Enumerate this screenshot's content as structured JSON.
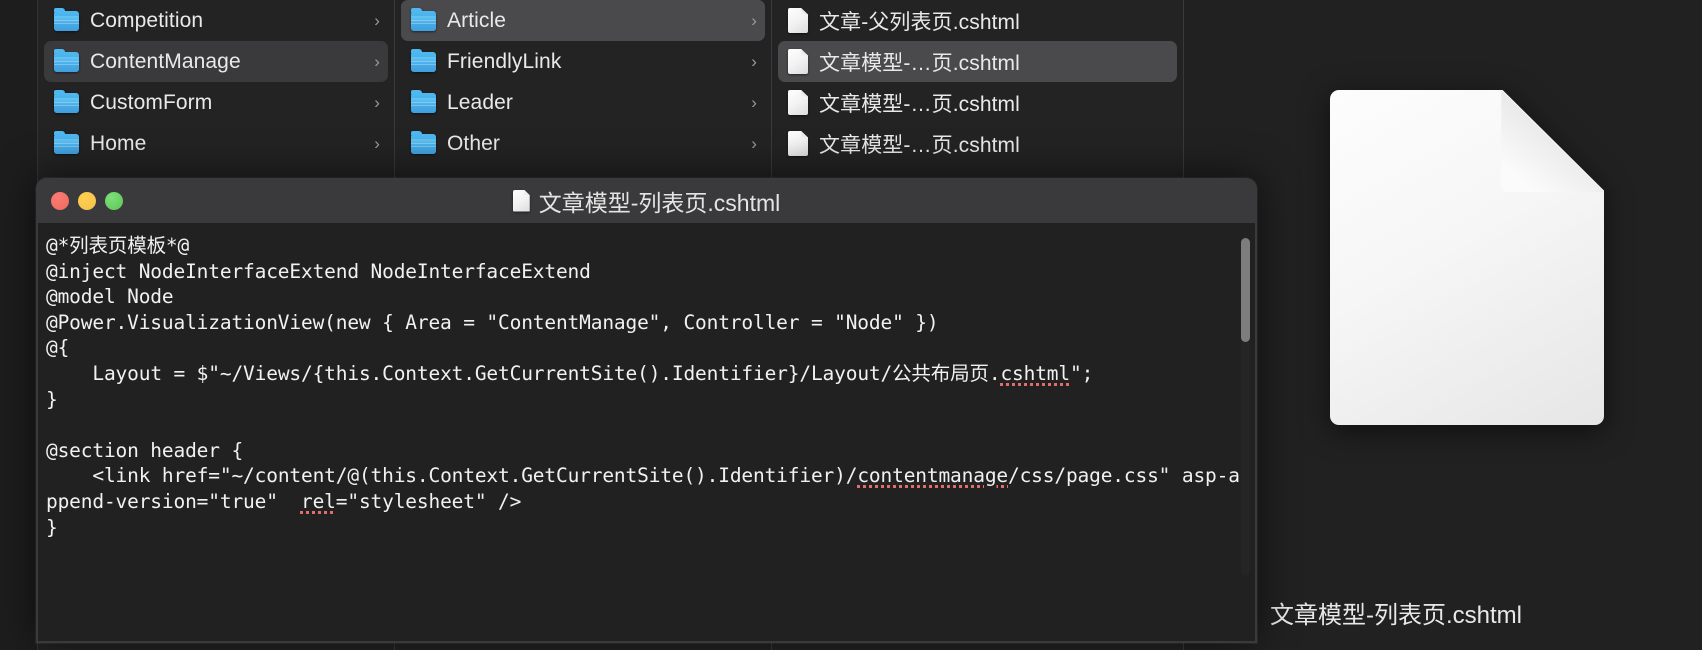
{
  "finder": {
    "columns": [
      {
        "name": "areas-column",
        "items": [
          {
            "label": "Competition",
            "icon": "folder-icon",
            "state": "normal",
            "chevron": "›"
          },
          {
            "label": "ContentManage",
            "icon": "folder-icon",
            "state": "selected",
            "chevron": "›"
          },
          {
            "label": "CustomForm",
            "icon": "folder-icon",
            "state": "normal",
            "chevron": "›"
          },
          {
            "label": "Home",
            "icon": "folder-icon",
            "state": "normal",
            "chevron": "›"
          }
        ]
      },
      {
        "name": "controllers-column",
        "items": [
          {
            "label": "Article",
            "icon": "folder-icon",
            "state": "selected-strong",
            "chevron": "›"
          },
          {
            "label": "FriendlyLink",
            "icon": "folder-icon",
            "state": "normal",
            "chevron": "›"
          },
          {
            "label": "Leader",
            "icon": "folder-icon",
            "state": "normal",
            "chevron": "›"
          },
          {
            "label": "Other",
            "icon": "folder-icon",
            "state": "normal",
            "chevron": "›"
          }
        ]
      },
      {
        "name": "files-column",
        "items": [
          {
            "label": "文章-父列表页.cshtml",
            "icon": "doc-icon",
            "state": "normal",
            "chevron": ""
          },
          {
            "label": "文章模型-…页.cshtml",
            "icon": "doc-icon",
            "state": "selected-strong",
            "chevron": ""
          },
          {
            "label": "文章模型-…页.cshtml",
            "icon": "doc-icon",
            "state": "normal",
            "chevron": ""
          },
          {
            "label": "文章模型-…页.cshtml",
            "icon": "doc-icon",
            "state": "normal",
            "chevron": ""
          }
        ]
      }
    ],
    "preview": {
      "icon": "document-icon",
      "filename": "文章模型-列表页.cshtml"
    }
  },
  "window": {
    "title": "文章模型-列表页.cshtml",
    "title_icon": "document-icon",
    "traffic_lights": {
      "close_label": "close",
      "minimize_label": "minimize",
      "zoom_label": "zoom",
      "close_color": "#ec6a5e",
      "minimize_color": "#f5bf4f",
      "zoom_color": "#61c554"
    },
    "code_lines": [
      "@*列表页模板*@",
      "@inject NodeInterfaceExtend NodeInterfaceExtend",
      "@model Node",
      "@Power.VisualizationView(new { Area = \"ContentManage\", Controller = \"Node\" })",
      "@{",
      "    Layout = $\"~/Views/{this.Context.GetCurrentSite().Identifier}/Layout/公共布局页.cshtml\";",
      "}",
      "",
      "@section header {",
      "    <link href=\"~/content/@(this.Context.GetCurrentSite().Identifier)/contentmanage/css/page.css\" asp-append-version=\"true\"  rel=\"stylesheet\" />",
      "}"
    ],
    "misspelled_words": [
      "cshtml",
      "contentmanage",
      "rel"
    ],
    "spellcheck_underline_color": "#e36d6d",
    "scrollbar": {
      "name": "vertical-scrollbar"
    }
  }
}
